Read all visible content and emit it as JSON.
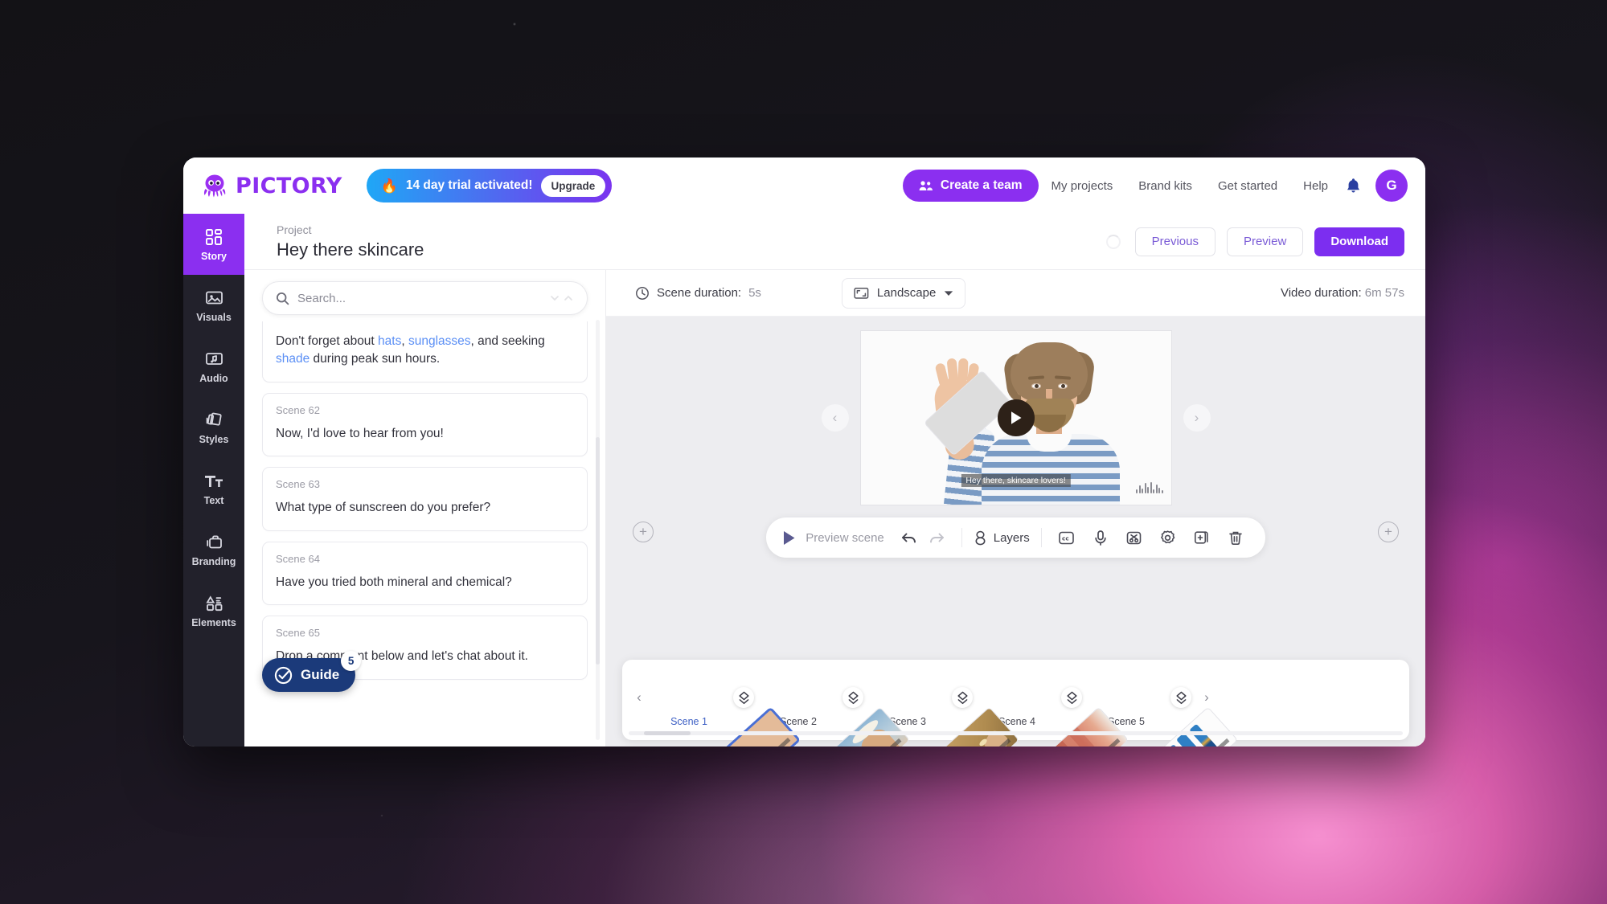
{
  "brand": {
    "logo_text": "PICTORY",
    "logo_icon": "octopus-icon",
    "accent": "#8b2ff0"
  },
  "topbar": {
    "trial": {
      "icon": "flame-icon",
      "label": "14 day trial activated!",
      "upgrade_label": "Upgrade"
    },
    "create_team_label": "Create a team",
    "create_team_icon": "people-group-icon",
    "nav_links": [
      {
        "label": "My projects"
      },
      {
        "label": "Brand kits"
      },
      {
        "label": "Get started"
      },
      {
        "label": "Help"
      }
    ],
    "bell_icon": "bell-icon",
    "avatar_initial": "G"
  },
  "rail": {
    "items": [
      {
        "label": "Story",
        "icon": "grid-blocks-icon",
        "active": true
      },
      {
        "label": "Visuals",
        "icon": "image-icon",
        "active": false
      },
      {
        "label": "Audio",
        "icon": "music-note-icon",
        "active": false
      },
      {
        "label": "Styles",
        "icon": "layers-cards-icon",
        "active": false
      },
      {
        "label": "Text",
        "icon": "text-tt-icon",
        "active": false
      },
      {
        "label": "Branding",
        "icon": "briefcase-icon",
        "active": false
      },
      {
        "label": "Elements",
        "icon": "shapes-icon",
        "active": false
      }
    ]
  },
  "project": {
    "label": "Project",
    "title": "Hey there skincare",
    "previous_label": "Previous",
    "preview_label": "Preview",
    "download_label": "Download"
  },
  "meta_bar": {
    "scene_duration_label": "Scene duration:",
    "scene_duration_value": "5s",
    "clock_icon": "clock-icon",
    "ratio_icon": "landscape-frame-icon",
    "ratio_value": "Landscape",
    "chevron_icon": "chevron-down-icon",
    "video_duration_label": "Video duration:",
    "video_duration_value": "6m 57s"
  },
  "search": {
    "placeholder": "Search...",
    "icon": "search-icon",
    "value": ""
  },
  "scenes": [
    {
      "number": "",
      "partial": true,
      "segments": [
        {
          "text": "Don't forget about ",
          "highlight": false
        },
        {
          "text": "hats",
          "highlight": true
        },
        {
          "text": ", ",
          "highlight": false
        },
        {
          "text": "sunglasses",
          "highlight": true
        },
        {
          "text": ", and seeking ",
          "highlight": false
        },
        {
          "text": "shade",
          "highlight": true
        },
        {
          "text": " during peak sun hours.",
          "highlight": false
        }
      ]
    },
    {
      "number": "Scene 62",
      "partial": false,
      "segments": [
        {
          "text": "Now, I'd love to hear from you!",
          "highlight": false
        }
      ]
    },
    {
      "number": "Scene 63",
      "partial": false,
      "segments": [
        {
          "text": "What type of sunscreen do you prefer?",
          "highlight": false
        }
      ]
    },
    {
      "number": "Scene 64",
      "partial": false,
      "segments": [
        {
          "text": "Have you tried both mineral and chemical?",
          "highlight": false
        }
      ]
    },
    {
      "number": "Scene 65",
      "partial": false,
      "segments": [
        {
          "text": "Drop a comment below and let's chat about it.",
          "highlight": false
        }
      ]
    }
  ],
  "guide": {
    "label": "Guide",
    "icon": "check-circle-icon",
    "badge_count": "5"
  },
  "player": {
    "play_icon": "play-icon",
    "subtitle_text": "Hey there, skincare lovers!",
    "prev_arrow_icon": "chevron-left-icon",
    "next_arrow_icon": "chevron-right-icon",
    "add_left_icon": "plus-circle-icon",
    "add_right_icon": "plus-circle-icon",
    "waveform_icon": "audio-waveform-icon"
  },
  "player_toolbar": {
    "play_icon": "play-icon",
    "preview_scene_label": "Preview scene",
    "undo_icon": "undo-icon",
    "redo_icon": "redo-icon",
    "layers_icon": "layers-eight-icon",
    "layers_label": "Layers",
    "tools": [
      {
        "icon": "closed-caption-icon",
        "name": "captions"
      },
      {
        "icon": "microphone-icon",
        "name": "voiceover"
      },
      {
        "icon": "scissors-icon",
        "name": "trim"
      },
      {
        "icon": "gear-icon",
        "name": "settings"
      },
      {
        "icon": "duplicate-icon",
        "name": "duplicate"
      },
      {
        "icon": "trash-icon",
        "name": "delete"
      }
    ]
  },
  "filmstrip": {
    "prev_icon": "chevron-left-icon",
    "next_icon": "chevron-right-icon",
    "split_icon": "split-scene-icon",
    "scenes": [
      {
        "label": "Scene 1",
        "selected": true,
        "thumb": "presenter-waving"
      },
      {
        "label": "Scene 2",
        "selected": false,
        "thumb": "beach-couple-hat"
      },
      {
        "label": "Scene 3",
        "selected": false,
        "thumb": "sunscreen-applying"
      },
      {
        "label": "Scene 4",
        "selected": false,
        "thumb": "sunburned-skin"
      },
      {
        "label": "Scene 5",
        "selected": false,
        "thumb": "sunscreen-bottles"
      }
    ]
  }
}
